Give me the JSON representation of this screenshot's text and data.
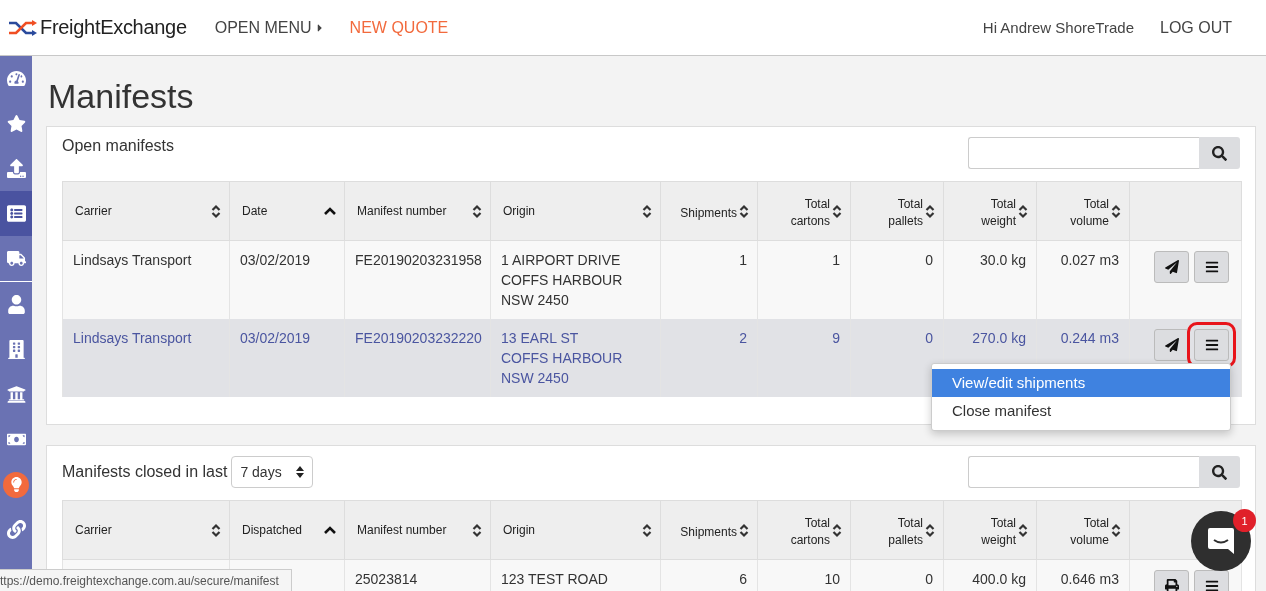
{
  "header": {
    "logo": "FreightExchange",
    "nav": [
      {
        "label": "OPEN MENU",
        "kind": "menu"
      },
      {
        "label": "NEW QUOTE",
        "kind": "accent"
      }
    ],
    "greeting": "Hi Andrew ShoreTrade",
    "logout": "LOG OUT"
  },
  "sidebar": {
    "groups": [
      [
        {
          "kind": "plain",
          "selected": false
        },
        {
          "kind": "plain",
          "selected": false
        },
        {
          "kind": "plain",
          "selected": false
        },
        {
          "kind": "plain",
          "selected": true
        },
        {
          "kind": "plain",
          "selected": false
        }
      ],
      [
        {
          "kind": "plain",
          "selected": false
        },
        {
          "kind": "plain",
          "selected": false
        },
        {
          "kind": "plain",
          "selected": false
        },
        {
          "kind": "plain",
          "selected": false
        },
        {
          "kind": "accent",
          "selected": false
        },
        {
          "kind": "plain",
          "selected": false
        }
      ]
    ]
  },
  "page_title": "Manifests",
  "open_panel": {
    "title": "Open manifests",
    "columns": [
      {
        "label": "Carrier",
        "sorted_ascending": false,
        "kind": "text"
      },
      {
        "label": "Date",
        "sorted_ascending": true,
        "kind": "text"
      },
      {
        "label": "Manifest number",
        "sorted_ascending": false,
        "kind": "text"
      },
      {
        "label": "Origin",
        "sorted_ascending": false,
        "kind": "text"
      },
      {
        "label": "Shipments",
        "sorted_ascending": false,
        "kind": "number"
      },
      {
        "label": "Total cartons",
        "sorted_ascending": false,
        "kind": "number"
      },
      {
        "label": "Total pallets",
        "sorted_ascending": false,
        "kind": "number"
      },
      {
        "label": "Total weight",
        "sorted_ascending": false,
        "kind": "number"
      },
      {
        "label": "Total volume",
        "sorted_ascending": false,
        "kind": "number"
      }
    ],
    "rows": [
      {
        "selected": false,
        "cells": [
          [
            "Lindsays Transport"
          ],
          [
            "03/02/2019"
          ],
          [
            "FE20190203231958"
          ],
          [
            "1 AIRPORT DRIVE",
            "COFFS HARBOUR",
            "NSW 2450"
          ],
          [
            "1"
          ],
          [
            "1"
          ],
          [
            "0"
          ],
          [
            "30.0 kg"
          ],
          [
            "0.027 m3"
          ]
        ],
        "actions": [
          {
            "kind": "send",
            "outlined": false
          },
          {
            "kind": "menu",
            "outlined": false
          }
        ]
      },
      {
        "selected": true,
        "cells": [
          [
            "Lindsays Transport"
          ],
          [
            "03/02/2019"
          ],
          [
            "FE20190203232220"
          ],
          [
            "13 EARL ST",
            "COFFS HARBOUR",
            "NSW 2450"
          ],
          [
            "2"
          ],
          [
            "9"
          ],
          [
            "0"
          ],
          [
            "270.0 kg"
          ],
          [
            "0.244 m3"
          ]
        ],
        "actions": [
          {
            "kind": "send",
            "outlined": false
          },
          {
            "kind": "menu",
            "outlined": true
          }
        ]
      }
    ],
    "dropdown": [
      {
        "label": "View/edit shipments",
        "selected": true
      },
      {
        "label": "Close manifest",
        "selected": false
      }
    ]
  },
  "closed_panel": {
    "title": "Manifests closed in last",
    "period": "7 days",
    "columns": [
      {
        "label": "Carrier",
        "sorted_ascending": false,
        "kind": "text"
      },
      {
        "label": "Dispatched",
        "sorted_ascending": true,
        "kind": "text"
      },
      {
        "label": "Manifest number",
        "sorted_ascending": false,
        "kind": "text"
      },
      {
        "label": "Origin",
        "sorted_ascending": false,
        "kind": "text"
      },
      {
        "label": "Shipments",
        "sorted_ascending": false,
        "kind": "number"
      },
      {
        "label": "Total cartons",
        "sorted_ascending": false,
        "kind": "number"
      },
      {
        "label": "Total pallets",
        "sorted_ascending": false,
        "kind": "number"
      },
      {
        "label": "Total weight",
        "sorted_ascending": false,
        "kind": "number"
      },
      {
        "label": "Total volume",
        "sorted_ascending": false,
        "kind": "number"
      }
    ],
    "rows": [
      {
        "selected": false,
        "cells": [
          [],
          [],
          [
            "25023814"
          ],
          [
            "123 TEST ROAD"
          ],
          [
            "6"
          ],
          [
            "10"
          ],
          [
            "0"
          ],
          [
            "400.0 kg"
          ],
          [
            "0.646 m3"
          ]
        ],
        "actions": [
          {
            "kind": "print",
            "outlined": false
          },
          {
            "kind": "menu",
            "outlined": false
          }
        ]
      }
    ]
  },
  "status_url": "ttps://demo.freightexchange.com.au/secure/manifest",
  "chat": {
    "badge": "1"
  }
}
